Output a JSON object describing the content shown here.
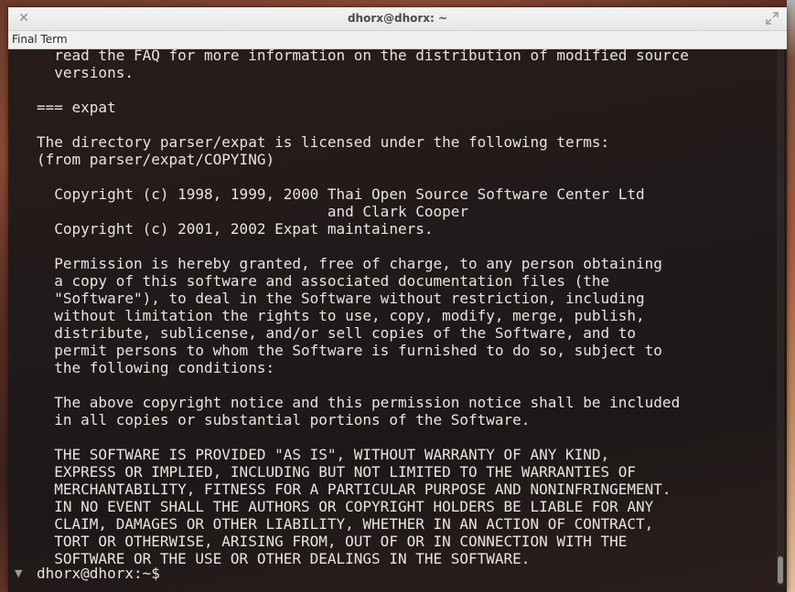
{
  "window": {
    "title": "dhorx@dhorx: ~",
    "app_name": "Final Term"
  },
  "terminal": {
    "lines": [
      "  read the FAQ for more information on the distribution of modified source",
      "  versions.",
      "",
      "=== expat",
      "",
      "The directory parser/expat is licensed under the following terms:",
      "(from parser/expat/COPYING)",
      "",
      "  Copyright (c) 1998, 1999, 2000 Thai Open Source Software Center Ltd",
      "                                 and Clark Cooper",
      "  Copyright (c) 2001, 2002 Expat maintainers.",
      "",
      "  Permission is hereby granted, free of charge, to any person obtaining",
      "  a copy of this software and associated documentation files (the",
      "  \"Software\"), to deal in the Software without restriction, including",
      "  without limitation the rights to use, copy, modify, merge, publish,",
      "  distribute, sublicense, and/or sell copies of the Software, and to",
      "  permit persons to whom the Software is furnished to do so, subject to",
      "  the following conditions:",
      "",
      "  The above copyright notice and this permission notice shall be included",
      "  in all copies or substantial portions of the Software.",
      "",
      "  THE SOFTWARE IS PROVIDED \"AS IS\", WITHOUT WARRANTY OF ANY KIND,",
      "  EXPRESS OR IMPLIED, INCLUDING BUT NOT LIMITED TO THE WARRANTIES OF",
      "  MERCHANTABILITY, FITNESS FOR A PARTICULAR PURPOSE AND NONINFRINGEMENT.",
      "  IN NO EVENT SHALL THE AUTHORS OR COPYRIGHT HOLDERS BE LIABLE FOR ANY",
      "  CLAIM, DAMAGES OR OTHER LIABILITY, WHETHER IN AN ACTION OF CONTRACT,",
      "  TORT OR OTHERWISE, ARISING FROM, OUT OF OR IN CONNECTION WITH THE",
      "  SOFTWARE OR THE USE OR OTHER DEALINGS IN THE SOFTWARE."
    ],
    "prompt": "dhorx@dhorx:~$"
  },
  "icons": {
    "close": "close-icon",
    "maximize": "maximize-icon",
    "collapse": "triangle-down-icon"
  }
}
